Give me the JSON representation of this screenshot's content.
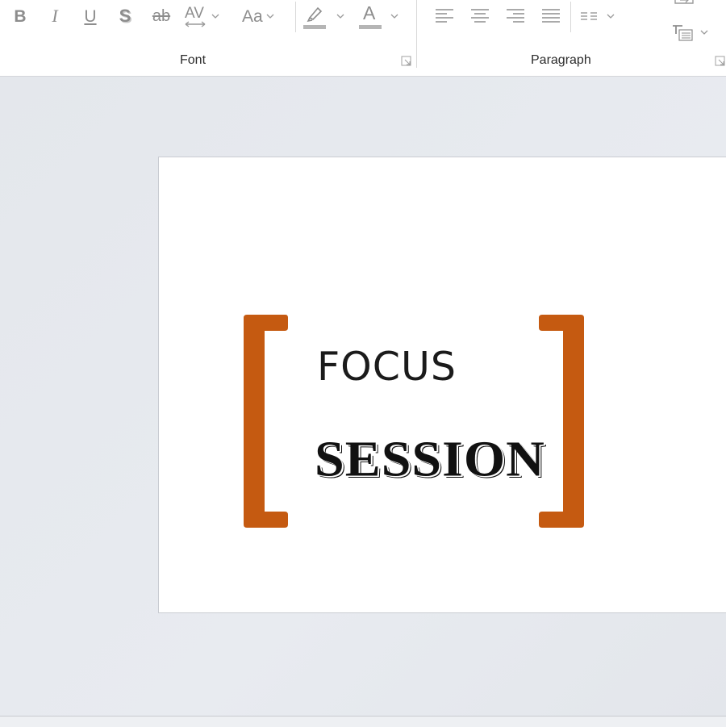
{
  "ribbon": {
    "font_group": {
      "label": "Font",
      "bold_glyph": "B",
      "italic_glyph": "I",
      "underline_glyph": "U",
      "shadow_glyph": "S",
      "strike_glyph": "ab",
      "spacing_glyph": "AV",
      "case_glyph": "Aa",
      "fontcolor_glyph": "A"
    },
    "paragraph_group": {
      "label": "Paragraph"
    }
  },
  "slide": {
    "line1": "FOCUS",
    "line2": "SESSION",
    "accent_color": "#c55a11"
  }
}
